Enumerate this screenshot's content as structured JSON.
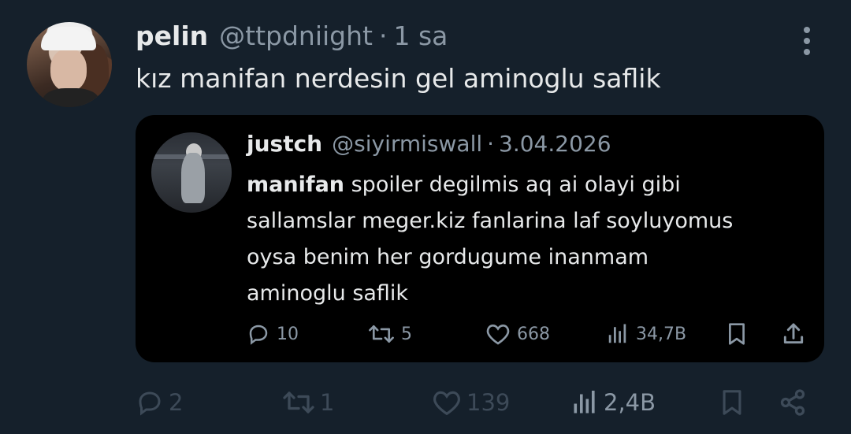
{
  "tweet": {
    "display_name": "pelin",
    "handle": "@ttpdniight",
    "separator": "·",
    "time": "1 sa",
    "text": "kız manifan nerdesin gel aminoglu saflik",
    "actions": {
      "replies": "2",
      "retweets": "1",
      "likes": "139",
      "views": "2,4B"
    }
  },
  "quote": {
    "display_name": "justch",
    "handle": "@siyirmiswall",
    "separator": "·",
    "date": "3.04.2026",
    "bold_lead": "manifan",
    "line1_rest": " spoiler degilmis aq ai olayi gibi",
    "line2": "sallamslar meger.kiz fanlarina laf soyluyomus",
    "line3": "oysa benim her gordugume inanmam",
    "line4": "aminoglu saflik",
    "actions": {
      "replies": "10",
      "retweets": "5",
      "likes": "668",
      "views": "34,7B"
    }
  },
  "colors": {
    "background": "#15202b",
    "card": "#000000",
    "text": "#e7e9ea",
    "muted": "#8b98a5",
    "dim": "#3d4a58"
  },
  "icons": [
    "more-icon",
    "reply-icon",
    "retweet-icon",
    "like-icon",
    "views-icon",
    "bookmark-icon",
    "share-icon",
    "upload-icon"
  ]
}
